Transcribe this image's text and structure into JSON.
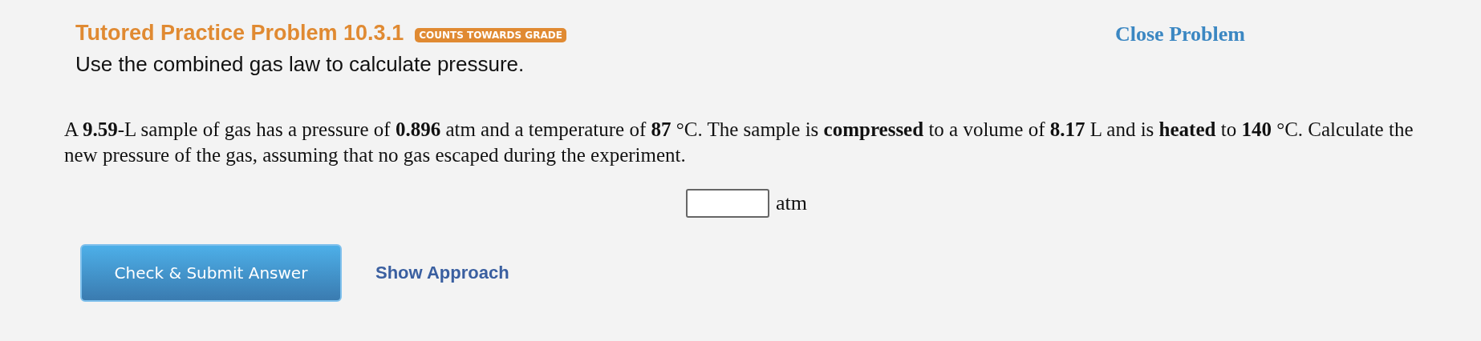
{
  "header": {
    "title": "Tutored Practice Problem 10.3.1",
    "badge": "COUNTS TOWARDS GRADE",
    "subtitle": "Use the combined gas law to calculate pressure.",
    "close_link": "Close Problem"
  },
  "problem": {
    "text": "A **9.59**-L sample of gas has a pressure of **0.896** atm and a temperature of **87** °C. The sample is **compressed** to a volume of **8.17** L and is **heated** to **140** °C. Calculate the new pressure of the gas, assuming that no gas escaped during the experiment."
  },
  "answer": {
    "unit": "atm"
  },
  "buttons": {
    "submit": "Check & Submit Answer",
    "approach": "Show Approach"
  }
}
